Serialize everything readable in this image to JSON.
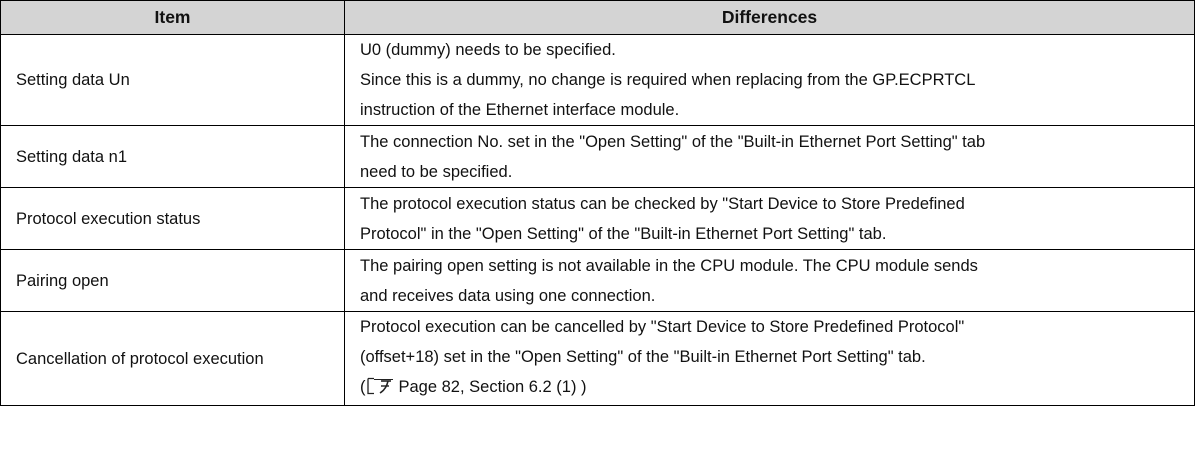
{
  "table": {
    "headers": {
      "item": "Item",
      "differences": "Differences"
    },
    "rows": [
      {
        "item": "Setting data Un",
        "lines": [
          "U0 (dummy) needs to be specified.",
          "Since this is a dummy, no change is required when replacing from the GP.ECPRTCL",
          "instruction of the Ethernet interface module."
        ]
      },
      {
        "item": "Setting data n1",
        "lines": [
          "The connection No. set in the \"Open Setting\" of the \"Built-in Ethernet Port Setting\" tab",
          "need to be specified."
        ]
      },
      {
        "item": "Protocol execution status",
        "lines": [
          "The protocol execution status can be checked by \"Start Device to Store Predefined",
          "Protocol\" in the \"Open Setting\" of the \"Built-in Ethernet Port Setting\" tab."
        ]
      },
      {
        "item": "Pairing open",
        "lines": [
          "The pairing open setting is not available in the CPU module. The CPU module sends",
          "and receives data using one connection."
        ]
      },
      {
        "item": "Cancellation of protocol execution",
        "lines": [
          "Protocol execution can be cancelled by \"Start Device to Store Predefined Protocol\"",
          "(offset+18) set in the \"Open Setting\" of the \"Built-in Ethernet Port Setting\" tab."
        ],
        "reference": {
          "open": "(",
          "text": "Page 82, Section 6.2 (1) )",
          "icon": "page-reference-icon"
        }
      }
    ]
  }
}
